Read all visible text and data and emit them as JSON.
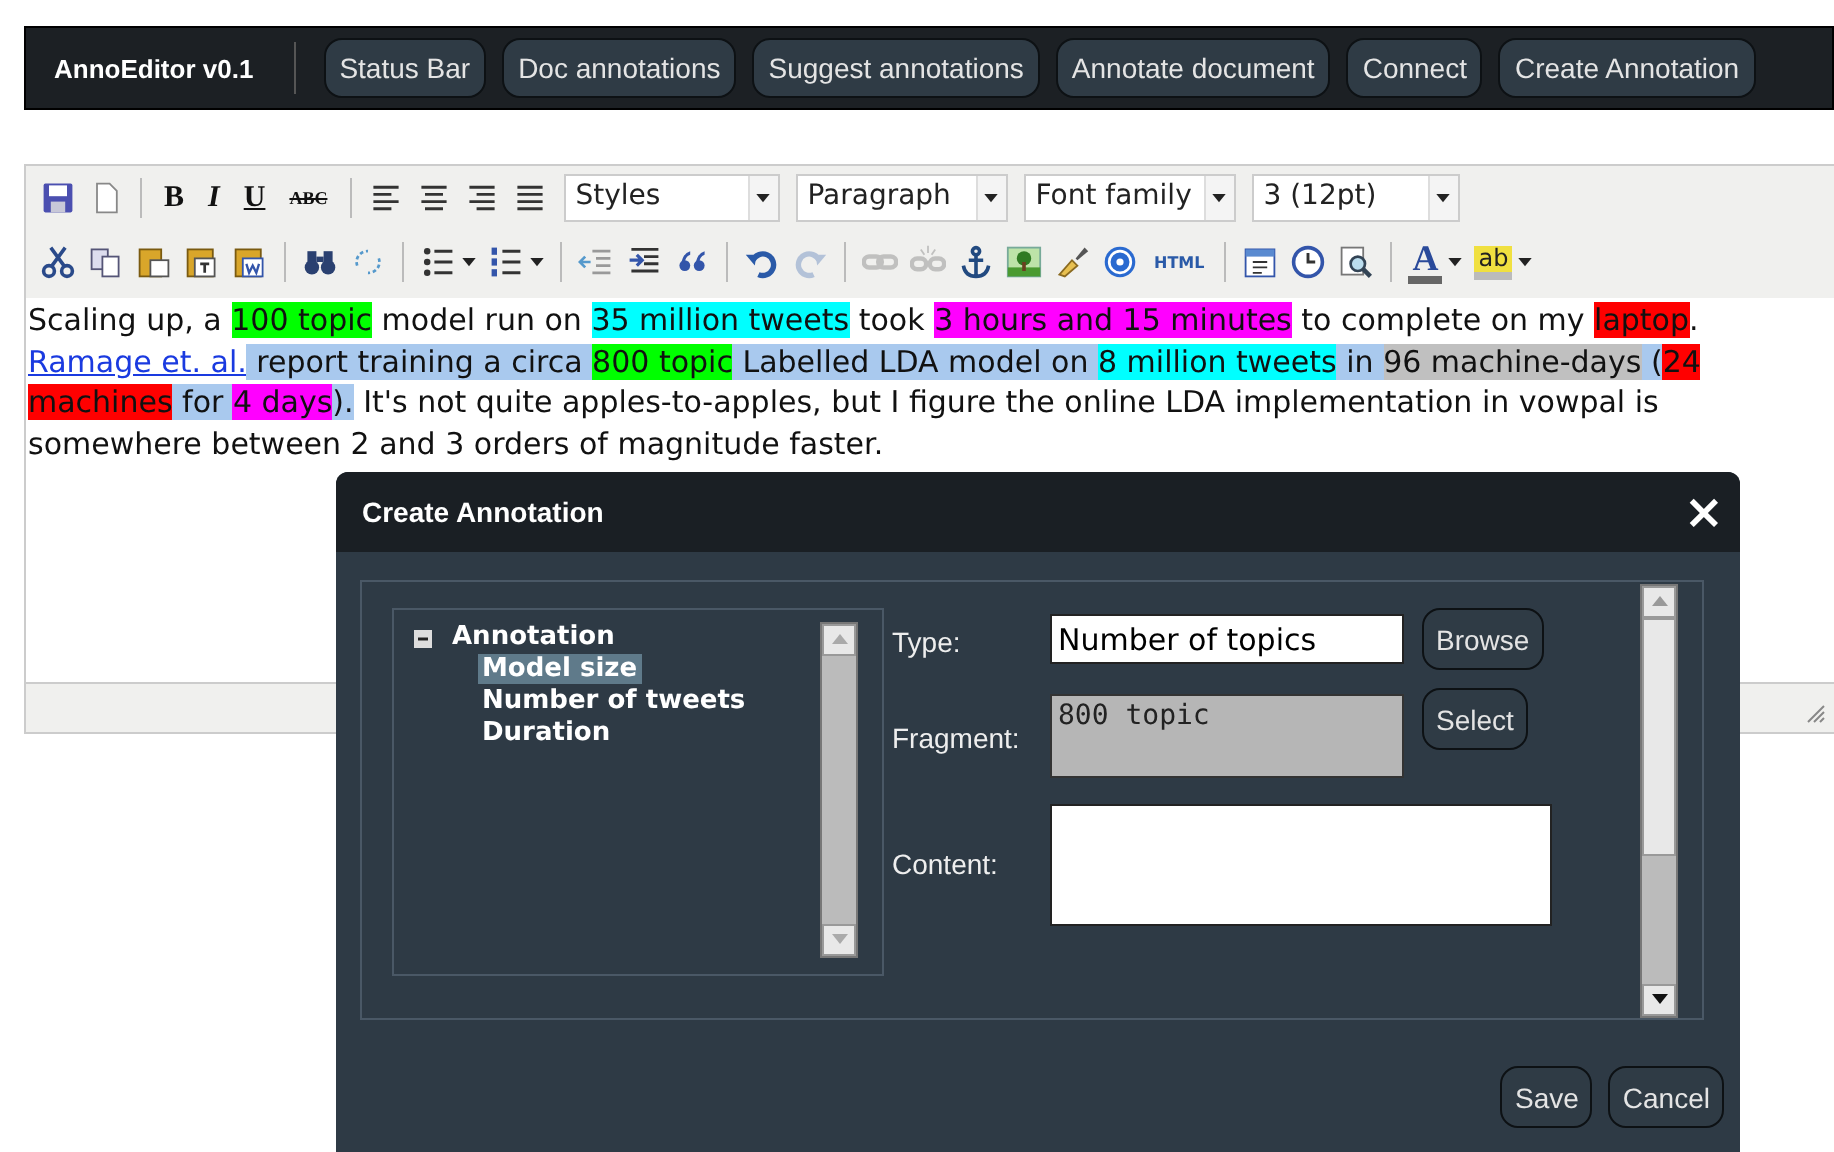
{
  "top_bar": {
    "brand": "AnnoEditor v0.1",
    "buttons": [
      "Status Bar",
      "Doc annotations",
      "Suggest annotations",
      "Annotate document",
      "Connect",
      "Create Annotation"
    ]
  },
  "editor": {
    "format_buttons": [
      "B",
      "I",
      "U",
      "ABC"
    ],
    "dropdowns": [
      "Styles",
      "Paragraph",
      "Font family",
      "3 (12pt)"
    ],
    "redo_button": {
      "disabled": true
    },
    "link_button": {
      "disabled": true
    },
    "unlink_button": {
      "disabled": true
    },
    "html_button": "HTML",
    "text_color_button": "A",
    "highlight_button": "ab",
    "content": [
      {
        "kind": "text",
        "text": "Scaling up, a "
      },
      {
        "kind": "text",
        "text": "100 topic",
        "color": "#00ff00"
      },
      {
        "kind": "text",
        "text": " model run on "
      },
      {
        "kind": "text",
        "text": "35 million tweets",
        "color": "#00ffff"
      },
      {
        "kind": "text",
        "text": " took "
      },
      {
        "kind": "text",
        "text": "3 hours and 15 minutes",
        "color": "#ff00ff"
      },
      {
        "kind": "text",
        "text": " to complete on my "
      },
      {
        "kind": "text",
        "text": "laptop",
        "color": "#ff0000"
      },
      {
        "kind": "text",
        "text": ". "
      },
      {
        "kind": "link",
        "text": "Ramage et. al."
      },
      {
        "kind": "text",
        "text": " report training a circa ",
        "color": "#a9c9ee"
      },
      {
        "kind": "text",
        "text": "800 topic",
        "color": "#00ff00"
      },
      {
        "kind": "text",
        "text": " Labelled LDA model on ",
        "color": "#a9c9ee"
      },
      {
        "kind": "text",
        "text": "8 million tweets",
        "color": "#00ffff"
      },
      {
        "kind": "text",
        "text": " in ",
        "color": "#a9c9ee"
      },
      {
        "kind": "text",
        "text": "96 machine-days",
        "color": "#c0c0c0"
      },
      {
        "kind": "text",
        "text": " (",
        "color": "#a9c9ee"
      },
      {
        "kind": "text",
        "text": "24 machines",
        "color": "#ff0000"
      },
      {
        "kind": "text",
        "text": " for ",
        "color": "#a9c9ee"
      },
      {
        "kind": "text",
        "text": "4 days",
        "color": "#ff00ff"
      },
      {
        "kind": "text",
        "text": ").",
        "color": "#a9c9ee"
      },
      {
        "kind": "text",
        "text": " It's not quite apples-to-apples, but I figure the online LDA implementation in vowpal is somewhere between 2 and 3 orders of magnitude faster."
      }
    ]
  },
  "dialog": {
    "title": "Create Annotation",
    "close": "×",
    "tree": [
      {
        "label": "Annotation",
        "expanded": true,
        "selected": false,
        "children": [
          {
            "label": "Model size",
            "selected": true
          },
          {
            "label": "Number of tweets",
            "selected": false
          },
          {
            "label": "Duration",
            "selected": false
          }
        ]
      }
    ],
    "type_label": "Type:",
    "type_value": "Number of topics",
    "browse_button": "Browse",
    "fragment_label": "Fragment:",
    "fragment_value": "800 topic",
    "fragment_disabled": true,
    "select_button": "Select",
    "content_label": "Content:",
    "buttons": [
      "Save",
      "Cancel"
    ]
  }
}
